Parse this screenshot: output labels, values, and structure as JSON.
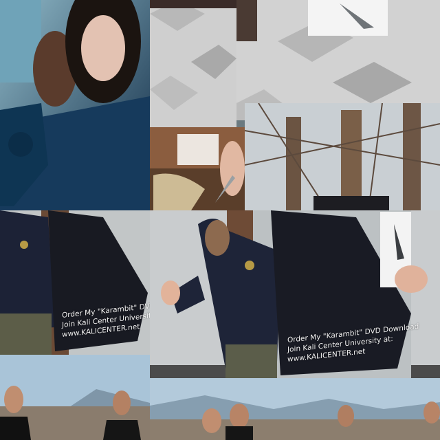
{
  "collage": {
    "caption_left": {
      "line1": "Order My \"Karambit\" DVD Download",
      "line2": "Join Kali Center University at:",
      "line3": "www.KALICENTER.net"
    },
    "caption_right": {
      "line1": "Order My \"Karambit\" DVD Download",
      "line2": "Join Kali Center University at:",
      "line3": "www.KALICENTER.net"
    }
  },
  "colors": {
    "movie_teal": "#1f5a7a",
    "hoodie_navy": "#1c2236",
    "wall_gray": "#bfc5c7",
    "sky_blue": "#a9c4d8",
    "tile_floor": "#cfcfcf"
  }
}
